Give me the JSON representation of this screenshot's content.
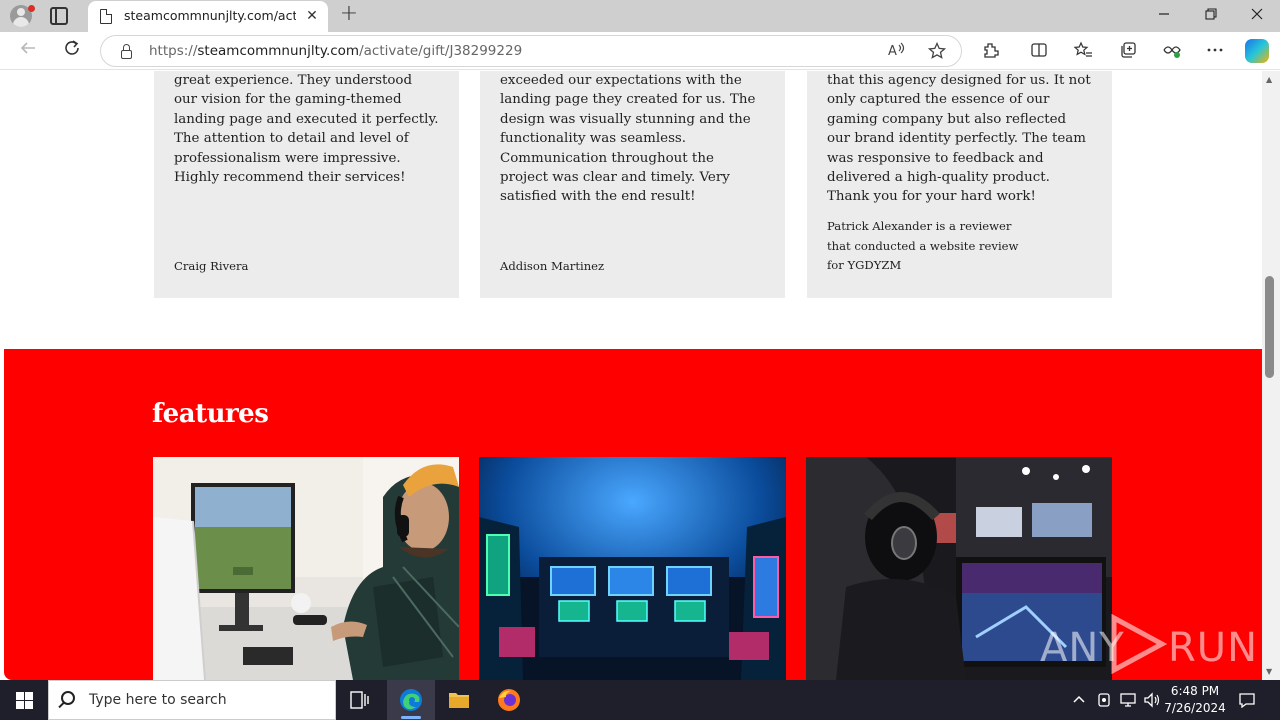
{
  "browser": {
    "tab_title": "steamcommnunjlty.com/activate/",
    "tab_close": "✕",
    "url_scheme": "https://",
    "url_host": "steamcommnunjlty.com",
    "url_path": "/activate/gift/J38299229"
  },
  "reviews": [
    {
      "text": "great experience. They understood our vision for the gaming-themed landing page and executed it perfectly. The attention to detail and level of professionalism were impressive. Highly recommend their services!",
      "author": "Craig Rivera"
    },
    {
      "text": "exceeded our expectations with the landing page they created for us. The design was visually stunning and the functionality was seamless. Communication throughout the project was clear and timely. Very satisfied with the end result!",
      "author": "Addison Martinez"
    },
    {
      "text": "that this agency designed for us. It not only captured the essence of our gaming company but also reflected our brand identity perfectly. The team was responsive to feedback and delivered a high-quality product. Thank you for your hard work!",
      "author": "Patrick Alexander is a reviewer that conducted a website review for YGDYZM"
    }
  ],
  "features": {
    "title": "features"
  },
  "watermark": {
    "left": "ANY",
    "right": "RUN"
  },
  "taskbar": {
    "search_placeholder": "Type here to search",
    "time": "6:48 PM",
    "date": "7/26/2024"
  },
  "colors": {
    "features_bg": "#ff0000",
    "review_card_bg": "#ececec",
    "taskbar_bg": "#1f1f2b"
  }
}
